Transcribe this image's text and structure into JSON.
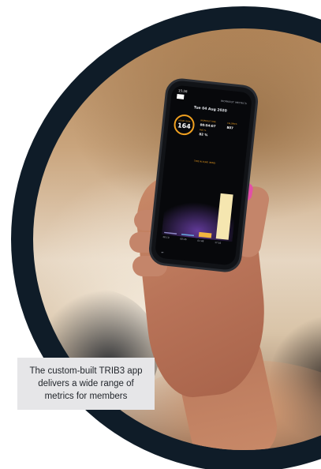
{
  "phone": {
    "status_time": "15:26",
    "nav_right": "WORKOUT METRICS",
    "date": "Tue 04 Aug 2020",
    "heart_rate": {
      "label": "HEART RATE",
      "value": "164"
    },
    "stats": {
      "time_label": "WORKOUT TIME",
      "time_value": "00:54:07",
      "calories_label": "CALORIES",
      "calories_value": "807",
      "effort_label": "AVG %",
      "effort_value": "82 %"
    },
    "zone_title": "TIME IN ZONE (MINS)",
    "zone_labels": [
      "00:10",
      "00:26",
      "01:48",
      "17:16"
    ]
  },
  "chart_data": {
    "type": "bar",
    "categories": [
      "00:10",
      "00:26",
      "01:48",
      "17:16"
    ],
    "values": [
      0.17,
      0.43,
      1.8,
      17.27
    ],
    "ylim": [
      0,
      18
    ],
    "colors": [
      "#8f88c8",
      "#66a8e0",
      "#f2b640",
      "#f5e6b0"
    ],
    "glow_color": "#6b3fa8"
  },
  "caption": {
    "text": "The custom-built TRIB3 app delivers a wide range of metrics for members"
  },
  "colors": {
    "ring": "#0f1c28",
    "caption_bg": "#e6e6e8",
    "accent": "#f0a020",
    "nail": "#e24fa8"
  }
}
